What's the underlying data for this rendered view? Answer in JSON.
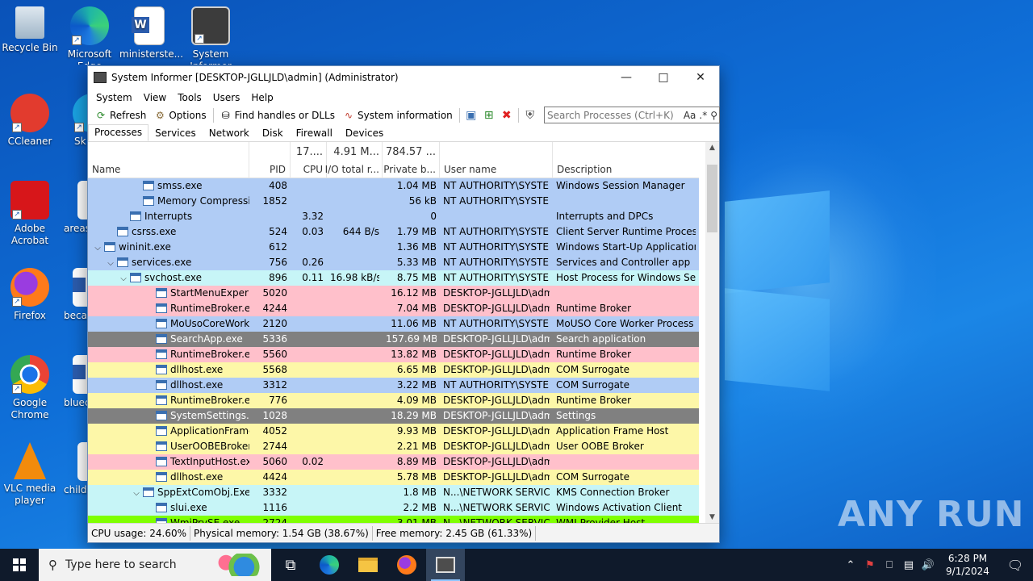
{
  "desktop": {
    "icons": [
      {
        "label": "Recycle Bin",
        "icon": "recycle-bin-icon"
      },
      {
        "label": "Microsoft Edge",
        "icon": "edge-icon"
      },
      {
        "label": "ministerste...",
        "icon": "word-doc-icon"
      },
      {
        "label": "System Informer",
        "icon": "system-informer-icon"
      },
      {
        "label": "CCleaner",
        "icon": "ccleaner-icon"
      },
      {
        "label": "Sk",
        "icon": "skype-icon"
      },
      {
        "label": "Adobe Acrobat",
        "icon": "acrobat-icon"
      },
      {
        "label": "areas",
        "icon": "word-doc-icon"
      },
      {
        "label": "Firefox",
        "icon": "firefox-icon"
      },
      {
        "label": "becau",
        "icon": "word-doc-icon"
      },
      {
        "label": "Google Chrome",
        "icon": "chrome-icon"
      },
      {
        "label": "bluec",
        "icon": "word-doc-icon"
      },
      {
        "label": "VLC media player",
        "icon": "vlc-icon"
      },
      {
        "label": "childr",
        "icon": "word-doc-icon"
      }
    ],
    "watermark": "ANY RUN"
  },
  "window": {
    "title": "System Informer [DESKTOP-JGLLJLD\\admin] (Administrator)",
    "menu": [
      "System",
      "View",
      "Tools",
      "Users",
      "Help"
    ],
    "toolbar": {
      "refresh": "Refresh",
      "options": "Options",
      "find": "Find handles or DLLs",
      "sysinfo": "System information"
    },
    "search_placeholder": "Search Processes (Ctrl+K)",
    "search_case": "Aa",
    "search_regex": ".*",
    "tabs": [
      "Processes",
      "Services",
      "Network",
      "Disk",
      "Firewall",
      "Devices"
    ],
    "columns": {
      "name": "Name",
      "pid": "PID",
      "cpu": "CPU",
      "io": "I/O total r...",
      "private": "Private b...",
      "user": "User name",
      "desc": "Description"
    },
    "totals": {
      "cpu": "17....",
      "io": "4.91 M...",
      "private": "784.57 ..."
    },
    "processes": [
      {
        "name": "smss.exe",
        "pid": "408",
        "cpu": "",
        "io": "",
        "private": "1.04 MB",
        "user": "NT AUTHORITY\\SYSTEM",
        "desc": "Windows Session Manager",
        "color": "#b0ccf5",
        "indent": 3,
        "tw": ""
      },
      {
        "name": "Memory Compression",
        "pid": "1852",
        "cpu": "",
        "io": "",
        "private": "56 kB",
        "user": "NT AUTHORITY\\SYSTEM",
        "desc": "",
        "color": "#b0ccf5",
        "indent": 3,
        "tw": ""
      },
      {
        "name": "Interrupts",
        "pid": "",
        "cpu": "3.32",
        "io": "",
        "private": "0",
        "user": "",
        "desc": "Interrupts and DPCs",
        "color": "#b0ccf5",
        "indent": 2,
        "tw": ""
      },
      {
        "name": "csrss.exe",
        "pid": "524",
        "cpu": "0.03",
        "io": "644 B/s",
        "private": "1.79 MB",
        "user": "NT AUTHORITY\\SYSTEM",
        "desc": "Client Server Runtime Process",
        "color": "#b0ccf5",
        "indent": 1,
        "tw": ""
      },
      {
        "name": "wininit.exe",
        "pid": "612",
        "cpu": "",
        "io": "",
        "private": "1.36 MB",
        "user": "NT AUTHORITY\\SYSTEM",
        "desc": "Windows Start-Up Application",
        "color": "#b0ccf5",
        "indent": 0,
        "tw": "v"
      },
      {
        "name": "services.exe",
        "pid": "756",
        "cpu": "0.26",
        "io": "",
        "private": "5.33 MB",
        "user": "NT AUTHORITY\\SYSTEM",
        "desc": "Services and Controller app",
        "color": "#b0ccf5",
        "indent": 1,
        "tw": "v"
      },
      {
        "name": "svchost.exe",
        "pid": "896",
        "cpu": "0.11",
        "io": "16.98 kB/s",
        "private": "8.75 MB",
        "user": "NT AUTHORITY\\SYSTEM",
        "desc": "Host Process for Windows Ser...",
        "color": "#c7f5f7",
        "indent": 2,
        "tw": "v"
      },
      {
        "name": "StartMenuExperie...",
        "pid": "5020",
        "cpu": "",
        "io": "",
        "private": "16.12 MB",
        "user": "DESKTOP-JGLLJLD\\admi",
        "desc": "",
        "color": "#ffc0cb",
        "indent": 4,
        "tw": ""
      },
      {
        "name": "RuntimeBroker.exe",
        "pid": "4244",
        "cpu": "",
        "io": "",
        "private": "7.04 MB",
        "user": "DESKTOP-JGLLJLD\\admi",
        "desc": "Runtime Broker",
        "color": "#ffc0cb",
        "indent": 4,
        "tw": ""
      },
      {
        "name": "MoUsoCoreWork...",
        "pid": "2120",
        "cpu": "",
        "io": "",
        "private": "11.06 MB",
        "user": "NT AUTHORITY\\SYSTEM",
        "desc": "MoUSO Core Worker Process",
        "color": "#b0ccf5",
        "indent": 4,
        "tw": ""
      },
      {
        "name": "SearchApp.exe",
        "pid": "5336",
        "cpu": "",
        "io": "",
        "private": "157.69 MB",
        "user": "DESKTOP-JGLLJLD\\admi",
        "desc": "Search application",
        "color": "#808080",
        "indent": 4,
        "tw": ""
      },
      {
        "name": "RuntimeBroker.exe",
        "pid": "5560",
        "cpu": "",
        "io": "",
        "private": "13.82 MB",
        "user": "DESKTOP-JGLLJLD\\admi",
        "desc": "Runtime Broker",
        "color": "#ffc0cb",
        "indent": 4,
        "tw": ""
      },
      {
        "name": "dllhost.exe",
        "pid": "5568",
        "cpu": "",
        "io": "",
        "private": "6.65 MB",
        "user": "DESKTOP-JGLLJLD\\admi",
        "desc": "COM Surrogate",
        "color": "#fdf7a8",
        "indent": 4,
        "tw": ""
      },
      {
        "name": "dllhost.exe",
        "pid": "3312",
        "cpu": "",
        "io": "",
        "private": "3.22 MB",
        "user": "NT AUTHORITY\\SYSTEM",
        "desc": "COM Surrogate",
        "color": "#b0ccf5",
        "indent": 4,
        "tw": ""
      },
      {
        "name": "RuntimeBroker.exe",
        "pid": "776",
        "cpu": "",
        "io": "",
        "private": "4.09 MB",
        "user": "DESKTOP-JGLLJLD\\admi",
        "desc": "Runtime Broker",
        "color": "#fdf7a8",
        "indent": 4,
        "tw": ""
      },
      {
        "name": "SystemSettings.exe",
        "pid": "1028",
        "cpu": "",
        "io": "",
        "private": "18.29 MB",
        "user": "DESKTOP-JGLLJLD\\admi",
        "desc": "Settings",
        "color": "#808080",
        "indent": 4,
        "tw": ""
      },
      {
        "name": "ApplicationFrame...",
        "pid": "4052",
        "cpu": "",
        "io": "",
        "private": "9.93 MB",
        "user": "DESKTOP-JGLLJLD\\admi",
        "desc": "Application Frame Host",
        "color": "#fdf7a8",
        "indent": 4,
        "tw": ""
      },
      {
        "name": "UserOOBEBroker....",
        "pid": "2744",
        "cpu": "",
        "io": "",
        "private": "2.21 MB",
        "user": "DESKTOP-JGLLJLD\\admi",
        "desc": "User OOBE Broker",
        "color": "#fdf7a8",
        "indent": 4,
        "tw": ""
      },
      {
        "name": "TextInputHost.exe",
        "pid": "5060",
        "cpu": "0.02",
        "io": "",
        "private": "8.89 MB",
        "user": "DESKTOP-JGLLJLD\\admi",
        "desc": "",
        "color": "#ffc0cb",
        "indent": 4,
        "tw": ""
      },
      {
        "name": "dllhost.exe",
        "pid": "4424",
        "cpu": "",
        "io": "",
        "private": "5.78 MB",
        "user": "DESKTOP-JGLLJLD\\admi",
        "desc": "COM Surrogate",
        "color": "#fdf7a8",
        "indent": 4,
        "tw": ""
      },
      {
        "name": "SppExtComObj.Exe",
        "pid": "3332",
        "cpu": "",
        "io": "",
        "private": "1.8 MB",
        "user": "N...\\NETWORK SERVICE",
        "desc": "KMS Connection Broker",
        "color": "#c7f5f7",
        "indent": 3,
        "tw": "v"
      },
      {
        "name": "slui.exe",
        "pid": "1116",
        "cpu": "",
        "io": "",
        "private": "2.2 MB",
        "user": "N...\\NETWORK SERVICE",
        "desc": "Windows Activation Client",
        "color": "#c7f5f7",
        "indent": 4,
        "tw": ""
      },
      {
        "name": "WmiPrvSE.exe",
        "pid": "2724",
        "cpu": "",
        "io": "",
        "private": "3.01 MB",
        "user": "N...\\NETWORK SERVICE",
        "desc": "WMI Provider Host",
        "color": "#7fff00",
        "indent": 4,
        "tw": ""
      }
    ],
    "status": {
      "cpu": "CPU usage: 24.60%",
      "physical": "Physical memory: 1.54 GB (38.67%)",
      "free": "Free memory: 2.45 GB (61.33%)"
    }
  },
  "taskbar": {
    "search_placeholder": "Type here to search",
    "time": "6:28 PM",
    "date": "9/1/2024"
  }
}
